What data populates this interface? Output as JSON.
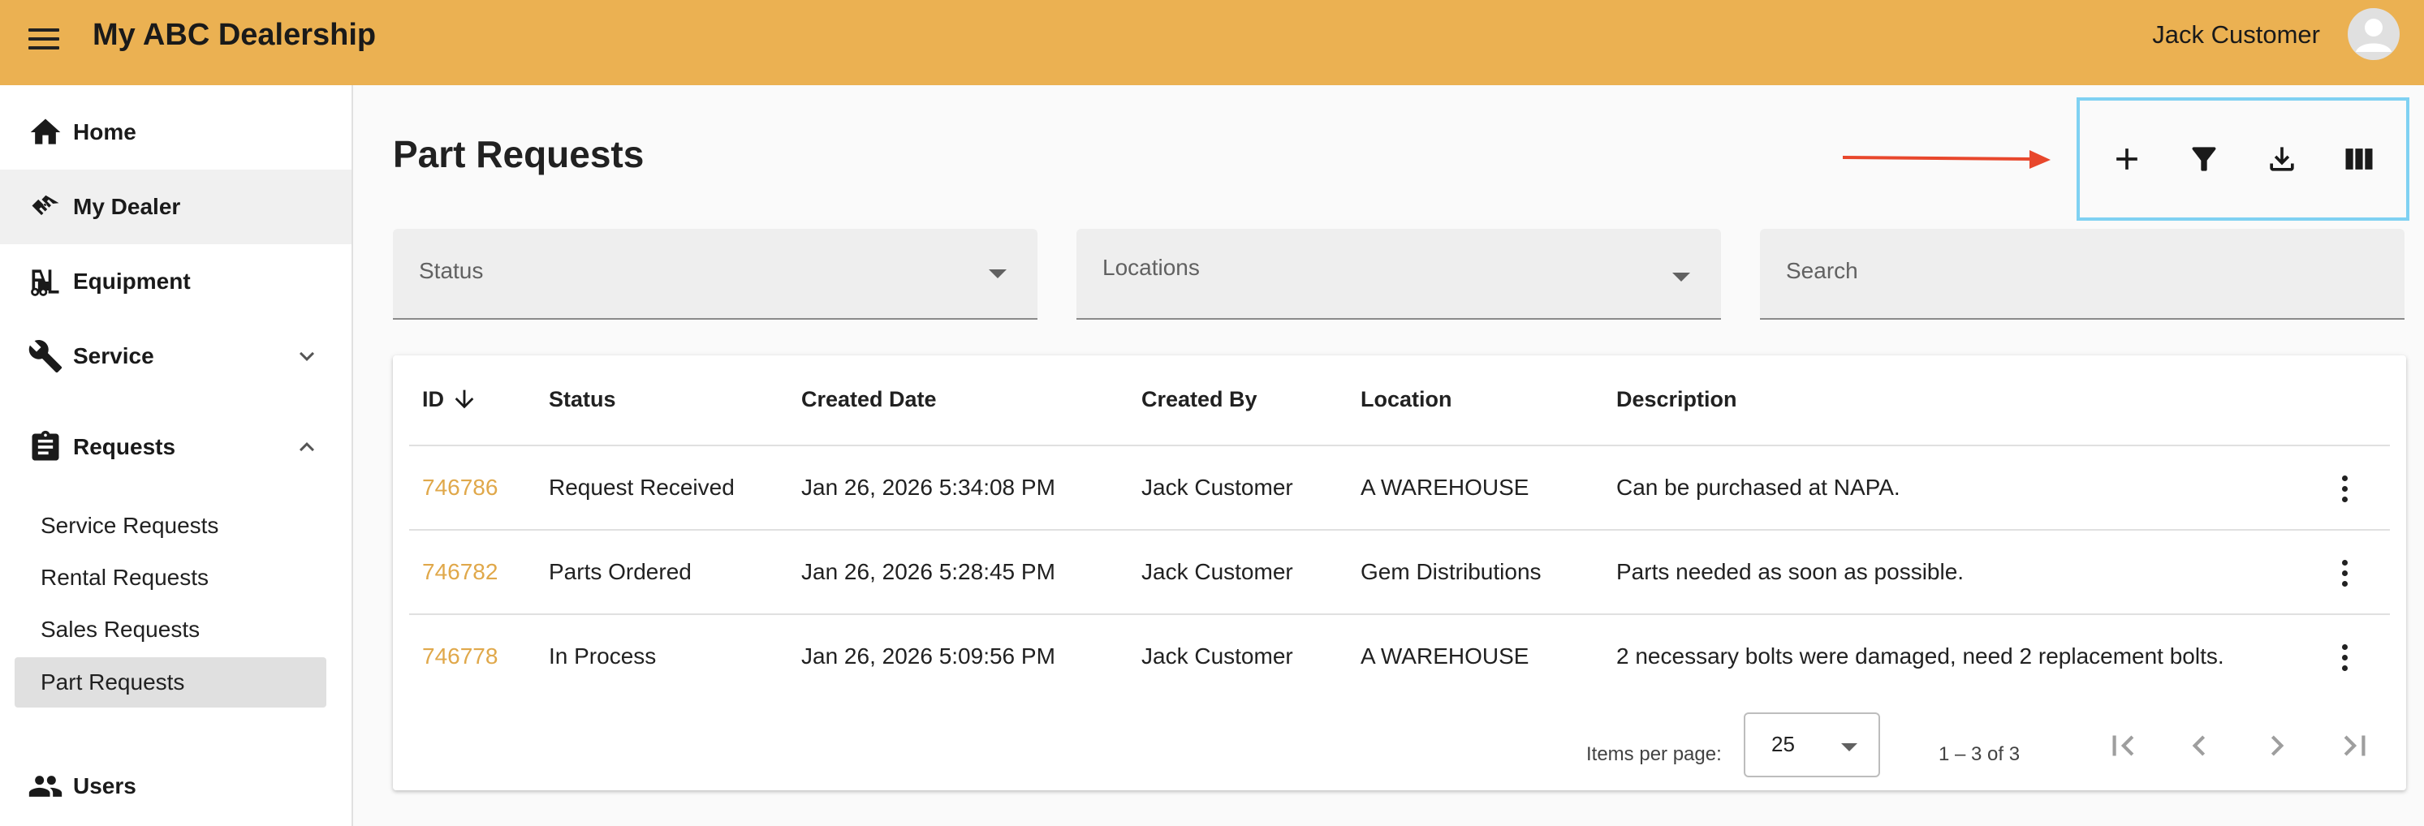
{
  "app": {
    "title": "My ABC Dealership"
  },
  "user": {
    "name": "Jack Customer"
  },
  "sidebar": {
    "items": [
      {
        "label": "Home",
        "icon": "home-icon"
      },
      {
        "label": "My Dealer",
        "icon": "handshake-icon"
      },
      {
        "label": "Equipment",
        "icon": "forklift-icon"
      },
      {
        "label": "Service",
        "icon": "wrench-icon"
      },
      {
        "label": "Requests",
        "icon": "clipboard-icon"
      },
      {
        "label": "Users",
        "icon": "people-icon"
      }
    ],
    "sub_items": [
      {
        "label": "Service Requests"
      },
      {
        "label": "Rental Requests"
      },
      {
        "label": "Sales Requests"
      },
      {
        "label": "Part Requests"
      }
    ]
  },
  "page": {
    "title": "Part Requests"
  },
  "toolbar": {
    "buttons": [
      {
        "icon": "add-icon"
      },
      {
        "icon": "filter-icon"
      },
      {
        "icon": "download-icon"
      },
      {
        "icon": "columns-icon"
      }
    ]
  },
  "filters": {
    "status_label": "Status",
    "locations_label": "Locations",
    "search_label": "Search"
  },
  "table": {
    "headers": [
      "ID",
      "Status",
      "Created Date",
      "Created By",
      "Location",
      "Description"
    ],
    "rows": [
      {
        "id": "746786",
        "status": "Request Received",
        "created_date": "Jan 26, 2026 5:34:08 PM",
        "created_by": "Jack Customer",
        "location": "A WAREHOUSE",
        "description": "Can be purchased at NAPA."
      },
      {
        "id": "746782",
        "status": "Parts Ordered",
        "created_date": "Jan 26, 2026 5:28:45 PM",
        "created_by": "Jack Customer",
        "location": "Gem Distributions",
        "description": "Parts needed as soon as possible."
      },
      {
        "id": "746778",
        "status": "In Process",
        "created_date": "Jan 26, 2026 5:09:56 PM",
        "created_by": "Jack Customer",
        "location": "A WAREHOUSE",
        "description": "2 necessary bolts were damaged, need 2 replacement bolts."
      }
    ]
  },
  "paginator": {
    "items_per_page_label": "Items per page:",
    "page_size": "25",
    "range_label": "1 – 3 of 3"
  },
  "colors": {
    "header_bg": "#ebb152",
    "link": "#e0a84a",
    "highlight_border": "#7fd1f2",
    "arrow": "#e8472c"
  }
}
